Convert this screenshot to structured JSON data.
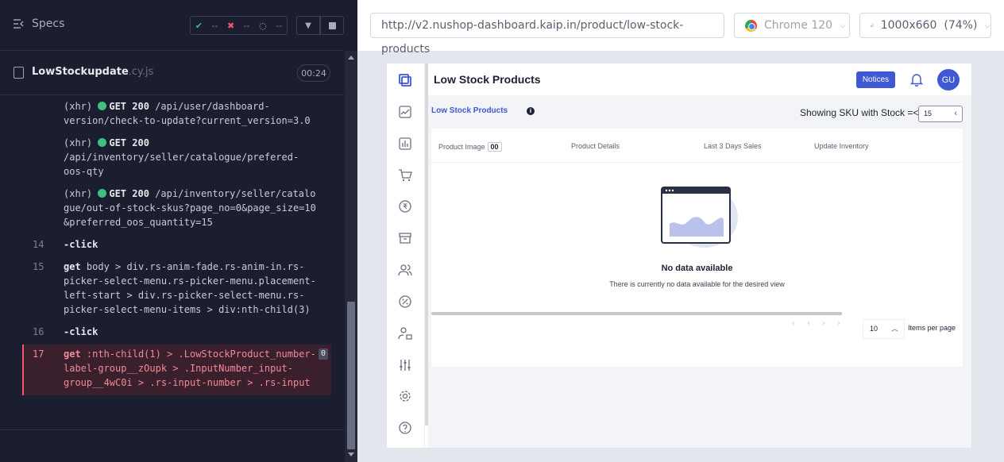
{
  "runner": {
    "specs_label": "Specs",
    "stats": {
      "passed": "--",
      "failed": "--",
      "pending": "--"
    },
    "spec_file": {
      "name": "LowStockupdate",
      "ext": ".cy.js",
      "duration": "00:24"
    },
    "log": [
      {
        "num": "",
        "type": "(xhr)",
        "method": "GET 200",
        "text": "/api/user/dashboard-version/check-to-update?current_version=3.0"
      },
      {
        "num": "",
        "type": "(xhr)",
        "method": "GET 200",
        "text": "/api/inventory/seller/catalogue/prefered-oos-qty"
      },
      {
        "num": "",
        "type": "(xhr)",
        "method": "GET 200",
        "text": "/api/inventory/seller/catalogue/out-of-stock-skus?page_no=0&page_size=10&preferred_oos_quantity=15"
      },
      {
        "num": "14",
        "cmd": "-click",
        "text": ""
      },
      {
        "num": "15",
        "cmd": "get",
        "text": "body > div.rs-anim-fade.rs-anim-in.rs-picker-select-menu.rs-picker-menu.placement-left-start > div.rs-picker-select-menu.rs-picker-select-menu-items > div:nth-child(3)"
      },
      {
        "num": "16",
        "cmd": "-click",
        "text": ""
      },
      {
        "num": "17",
        "cmd": "get",
        "text": ":nth-child(1) > .LowStockProduct_number-label-group__zOupk > .InputNumber_input-group__4wC0i > .rs-input-number > .rs-input",
        "badge": "0"
      }
    ]
  },
  "aut": {
    "url": "http://v2.nushop-dashboard.kaip.in/product/low-stock-products",
    "browser": "Chrome 120",
    "viewport": "1000x660",
    "zoom": "(74%)"
  },
  "app": {
    "page_title": "Low Stock Products",
    "notices_label": "Notices",
    "avatar_initials": "GU",
    "subtab_label": "Low Stock Products",
    "info_symbol": "i",
    "stock_filter_label": "Showing SKU with Stock =<:",
    "stock_filter_value": "15",
    "table": {
      "headers": [
        "Product Image",
        "Product Details",
        "Last 3 Days Sales",
        "Update Inventory"
      ],
      "image_badge": "00"
    },
    "empty_title": "No data available",
    "empty_subtitle": "There is currently no data available for the desired view",
    "items_per_page_value": "10",
    "items_per_page_label": "Items per page",
    "colors": {
      "accent": "#3f58d4",
      "runner_bg": "#1b1e2e",
      "pass": "#3fbf7f",
      "fail": "#f0576d"
    }
  }
}
